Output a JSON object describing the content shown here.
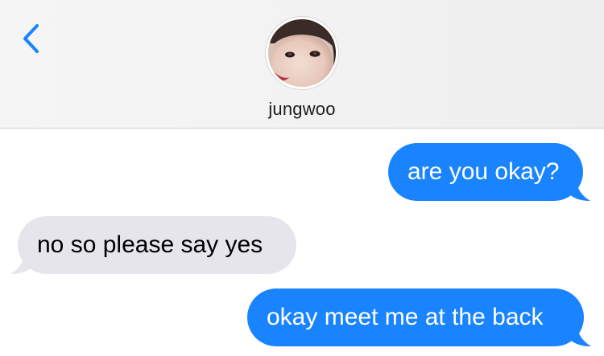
{
  "header": {
    "contact_name": "jungwoo",
    "back_icon": "chevron-left-icon",
    "accent_color": "#1a84ff"
  },
  "messages": [
    {
      "direction": "sent",
      "text": "are you okay?"
    },
    {
      "direction": "received",
      "text": "no so please say yes"
    },
    {
      "direction": "sent",
      "text": "okay meet me at the back"
    }
  ],
  "colors": {
    "sent_bubble": "#1a84ff",
    "received_bubble": "#e6e5eb",
    "header_bg": "#f3f3f3"
  }
}
